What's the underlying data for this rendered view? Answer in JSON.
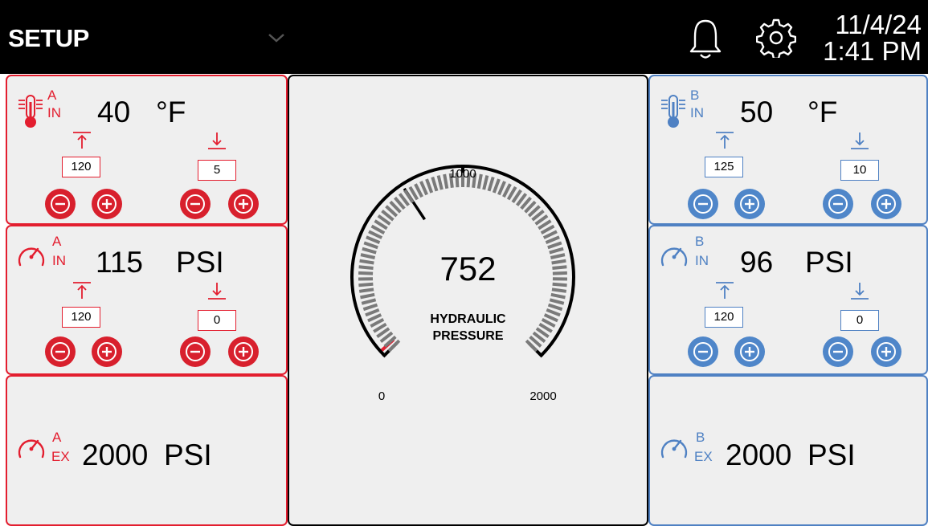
{
  "header": {
    "mode": "SETUP",
    "date": "11/4/24",
    "time": "1:41 PM",
    "icons": {
      "mode": "chevron-down-icon",
      "alerts": "bell-icon",
      "settings": "gear-icon"
    }
  },
  "colors": {
    "channel_a": "#e31e2f",
    "channel_b": "#4f81c3",
    "header_bg": "#000000",
    "panel_bg": "#efefef"
  },
  "channel_a": {
    "temp_in": {
      "label": "A",
      "port": "IN",
      "value": "40",
      "unit": "°F",
      "high_limit": "120",
      "low_limit": "5",
      "icon": "thermometer-icon"
    },
    "pressure_in": {
      "label": "A",
      "port": "IN",
      "value": "115",
      "unit": "PSI",
      "high_limit": "120",
      "low_limit": "0",
      "icon": "pressure-gauge-icon"
    },
    "pressure_ex": {
      "label": "A",
      "port": "EX",
      "value": "2000",
      "unit": "PSI",
      "icon": "pressure-gauge-icon"
    }
  },
  "channel_b": {
    "temp_in": {
      "label": "B",
      "port": "IN",
      "value": "50",
      "unit": "°F",
      "high_limit": "125",
      "low_limit": "10",
      "icon": "thermometer-icon"
    },
    "pressure_in": {
      "label": "B",
      "port": "IN",
      "value": "96",
      "unit": "PSI",
      "high_limit": "120",
      "low_limit": "0",
      "icon": "pressure-gauge-icon"
    },
    "pressure_ex": {
      "label": "B",
      "port": "EX",
      "value": "2000",
      "unit": "PSI",
      "icon": "pressure-gauge-icon"
    }
  },
  "hydraulic": {
    "reading": "752",
    "title_line1": "HYDRAULIC",
    "title_line2": "PRESSURE",
    "min_label": "0",
    "mid_label": "1000",
    "max_label": "2000",
    "min": 0,
    "max": 2000,
    "value": 752,
    "low_alarm": 0,
    "high_alarm": 2000
  }
}
